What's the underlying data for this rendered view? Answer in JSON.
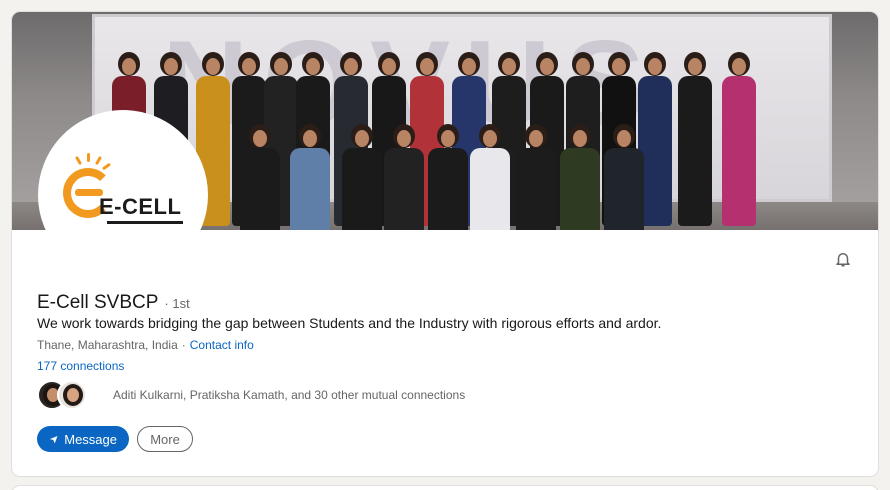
{
  "profile": {
    "name": "E-Cell SVBCP",
    "degree": "· 1st",
    "headline": "We work towards bridging the gap between Students and the Industry with rigorous efforts and ardor.",
    "location": "Thane, Maharashtra, India",
    "separator": "·",
    "contact_info": "Contact info",
    "connections": "177 connections",
    "mutual_connections": "Aditi Kulkarni, Pratiksha Kamath, and 30 other mutual connections"
  },
  "logo": {
    "text": "E-CELL",
    "accent_color": "#f29a1f"
  },
  "actions": {
    "message_label": "Message",
    "more_label": "More"
  },
  "icons": {
    "bell": "bell-icon",
    "message": "send-icon"
  },
  "colors": {
    "primary": "#0a66c2",
    "background": "#f4f2ee",
    "card": "#ffffff"
  }
}
